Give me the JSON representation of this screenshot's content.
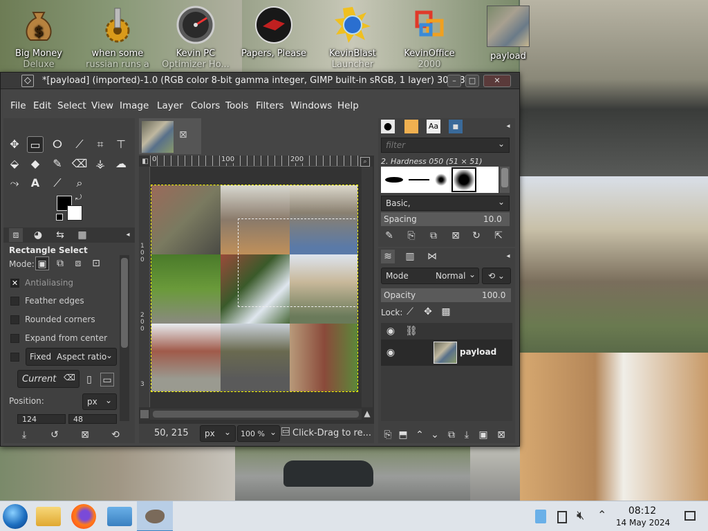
{
  "desktop": {
    "icons": [
      {
        "label": "Big Money",
        "sub": "Deluxe",
        "icon": "money-bag-icon"
      },
      {
        "label": "when some",
        "sub": "russian runs a",
        "icon": "gear-icon"
      },
      {
        "label": "Kevin PC",
        "sub": "Optimizer Ho...",
        "icon": "gauge-icon"
      },
      {
        "label": "Papers, Please",
        "sub": "",
        "icon": "papers-please-icon"
      },
      {
        "label": "KevinBlast",
        "sub": "Launcher",
        "icon": "kevinblast-icon"
      },
      {
        "label": "KevinOffice",
        "sub": "2000",
        "icon": "office-icon"
      },
      {
        "label": "payload",
        "sub": "",
        "icon": "image-thumbnail-icon"
      }
    ]
  },
  "window": {
    "title": "*[payload] (imported)-1.0 (RGB color 8-bit gamma integer, GIMP built-in sRGB, 1 layer) 300x3...",
    "min": "–",
    "max": "□",
    "close": "✕"
  },
  "menu": [
    "File",
    "Edit",
    "Select",
    "View",
    "Image",
    "Layer",
    "Colors",
    "Tools",
    "Filters",
    "Windows",
    "Help"
  ],
  "tool_options": {
    "title": "Rectangle Select",
    "mode_label": "Mode:",
    "antialiasing": "Antialiasing",
    "feather": "Feather edges",
    "rounded": "Rounded corners",
    "expand": "Expand from center",
    "fixed": "Fixed",
    "aspect": "Aspect ratio",
    "current": "Current",
    "position_label": "Position:",
    "unit": "px",
    "pos_x": "124",
    "pos_y": "48"
  },
  "canvas": {
    "ruler_top": [
      "0",
      "100",
      "200"
    ],
    "ruler_left": [
      "1",
      "0",
      "0",
      "2",
      "0",
      "0",
      "3"
    ]
  },
  "status": {
    "coords": "50, 215",
    "unit": "px",
    "zoom": "100 %",
    "message": "Click-Drag to re..."
  },
  "brushes": {
    "filter_placeholder": "filter",
    "brush_name": "2. Hardness 050 (51 × 51)",
    "preset": "Basic,",
    "spacing_label": "Spacing",
    "spacing_value": "10.0"
  },
  "layers": {
    "mode_label": "Mode",
    "mode_value": "Normal",
    "opacity_label": "Opacity",
    "opacity_value": "100.0",
    "lock_label": "Lock:",
    "layer_name": "payload"
  },
  "clock": {
    "time": "08:12",
    "date": "14 May 2024"
  }
}
